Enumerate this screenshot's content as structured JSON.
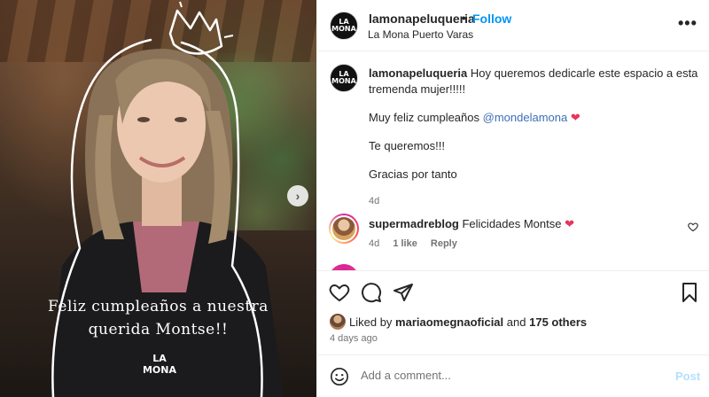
{
  "media": {
    "caption_line1": "Feliz cumpleaños a nuestra",
    "caption_line2": "querida Montse!!",
    "logo_text_top": "LA",
    "logo_text_bottom": "MONA",
    "next_glyph": "›"
  },
  "avatar_text": {
    "top": "LA",
    "bottom": "MONA"
  },
  "header": {
    "username": "lamonapeluqueria",
    "separator": "•",
    "follow_label": "Follow",
    "location": "La Mona Puerto Varas",
    "more_glyph": "•••"
  },
  "caption": {
    "username": "lamonapeluqueria",
    "line1": "Hoy queremos dedicarle este espacio a esta tremenda mujer!!!!!",
    "line2_text": "Muy feliz cumpleaños ",
    "line2_mention": "@mondelamona",
    "line2_emoji": "❤",
    "line3": "Te queremos!!!",
    "line4": "Gracias por tanto",
    "age": "4d"
  },
  "comments": [
    {
      "username": "supermadreblog",
      "text": "Felicidades Montse",
      "emoji": "❤",
      "age": "4d",
      "likes": "1 like",
      "reply_label": "Reply"
    }
  ],
  "likes": {
    "prefix": "Liked by",
    "user": "mariaomegnaoficial",
    "and": "and",
    "others": "175 others"
  },
  "posted_ago": "4 days ago",
  "add_comment": {
    "placeholder": "Add a comment...",
    "post_label": "Post"
  },
  "icons": [
    "heart-icon",
    "comment-icon",
    "share-icon",
    "bookmark-icon",
    "emoji-icon",
    "more-icon",
    "chevron-right-icon"
  ],
  "colors": {
    "follow": "#0095f6",
    "heart": "#e8355b",
    "post_disabled": "#b2dffc",
    "mention": "#3f6fb5"
  }
}
